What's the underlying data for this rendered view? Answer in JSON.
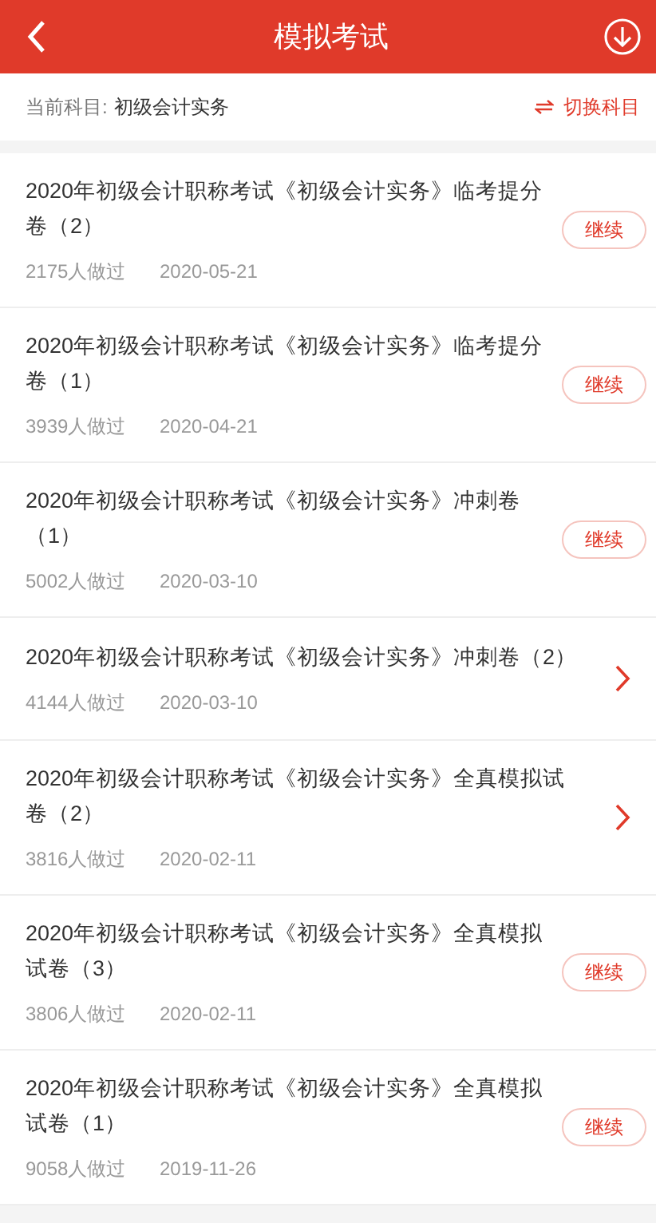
{
  "header": {
    "title": "模拟考试"
  },
  "subject": {
    "label": "当前科目:",
    "value": "初级会计实务",
    "switch_label": "切换科目"
  },
  "exams": [
    {
      "title_lines": [
        "2020年初级会计职称考试《初级会计实务》临考提分",
        "卷（2）"
      ],
      "count": "2175人做过",
      "date": "2020-05-21",
      "action": {
        "kind": "button",
        "label": "继续"
      }
    },
    {
      "title_lines": [
        "2020年初级会计职称考试《初级会计实务》临考提分",
        "卷（1）"
      ],
      "count": "3939人做过",
      "date": "2020-04-21",
      "action": {
        "kind": "button",
        "label": "继续"
      }
    },
    {
      "title_lines": [
        "2020年初级会计职称考试《初级会计实务》冲刺卷",
        "（1）"
      ],
      "count": "5002人做过",
      "date": "2020-03-10",
      "action": {
        "kind": "button",
        "label": "继续"
      }
    },
    {
      "title_lines": [
        "2020年初级会计职称考试《初级会计实务》冲刺卷（2）"
      ],
      "count": "4144人做过",
      "date": "2020-03-10",
      "action": {
        "kind": "chevron"
      }
    },
    {
      "title_lines": [
        "2020年初级会计职称考试《初级会计实务》全真模拟试",
        "卷（2）"
      ],
      "count": "3816人做过",
      "date": "2020-02-11",
      "action": {
        "kind": "chevron"
      }
    },
    {
      "title_lines": [
        "2020年初级会计职称考试《初级会计实务》全真模拟",
        "试卷（3）"
      ],
      "count": "3806人做过",
      "date": "2020-02-11",
      "action": {
        "kind": "button",
        "label": "继续"
      }
    },
    {
      "title_lines": [
        "2020年初级会计职称考试《初级会计实务》全真模拟",
        "试卷（1）"
      ],
      "count": "9058人做过",
      "date": "2019-11-26",
      "action": {
        "kind": "button",
        "label": "继续"
      }
    }
  ]
}
